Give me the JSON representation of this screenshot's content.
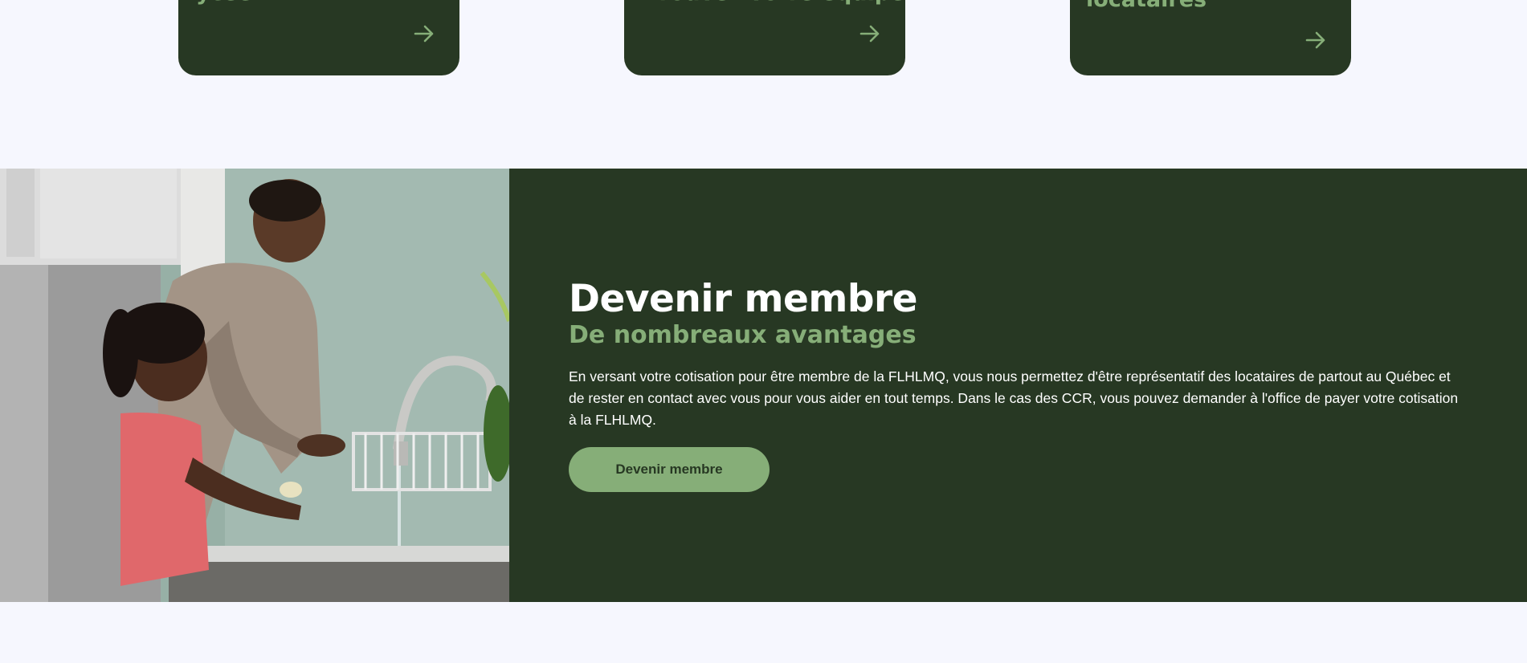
{
  "cards": [
    {
      "title": "ycee",
      "arrow_icon": "arrow-right-icon"
    },
    {
      "title": "Trouvez votre équipe",
      "arrow_icon": "arrow-right-icon"
    },
    {
      "title": "locataires",
      "arrow_icon": "arrow-right-icon"
    }
  ],
  "member_section": {
    "title": "Devenir membre",
    "subtitle": "De nombreaux avantages",
    "text": "En versant votre cotisation pour être membre de la FLHLMQ, vous nous permettez d'être représentatif des locataires de partout au Québec et de rester en contact avec vous pour vous aider en tout temps. Dans le cas des CCR, vous pouvez demander à l'office de payer votre cotisation à la FLHLMQ.",
    "button_label": "Devenir membre",
    "image": "parent-and-child-washing-hands-photo"
  },
  "colors": {
    "background": "#f6f7fe",
    "dark_green": "#273823",
    "accent_green": "#86ae78",
    "white": "#ffffff"
  }
}
